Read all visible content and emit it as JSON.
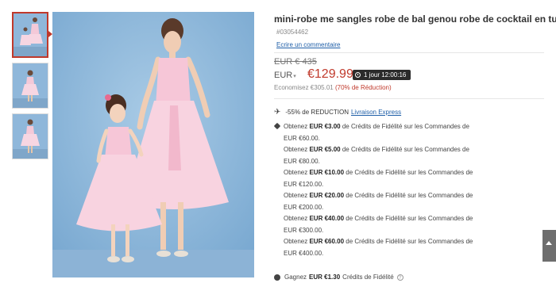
{
  "product": {
    "title": "mini-robe me sangles robe de bal genou robe de cocktail en tulle",
    "sku": "#03054462",
    "write_review": "Ecrire un commentaire"
  },
  "pricing": {
    "old_price": "EUR € 435",
    "currency_label": "EUR",
    "price": "€129.99",
    "countdown": "1 jour 12:00:16",
    "savings_label": "Economisez €305.01",
    "savings_pct": "(70% de Réduction)"
  },
  "shipping": {
    "discount_text": "-55% de REDUCTION",
    "link_text": "Livraison Express"
  },
  "rewards": [
    {
      "prefix": "Obtenez ",
      "amount": "EUR €3.00",
      "middle": " de Crédits de Fidélité sur les Commandes de",
      "threshold": "EUR €60.00."
    },
    {
      "prefix": "Obtenez ",
      "amount": "EUR €5.00",
      "middle": " de Crédits de Fidélité sur les Commandes de",
      "threshold": "EUR €80.00."
    },
    {
      "prefix": "Obtenez ",
      "amount": "EUR €10.00",
      "middle": " de Crédits de Fidélité sur les Commandes de",
      "threshold": "EUR €120.00."
    },
    {
      "prefix": "Obtenez ",
      "amount": "EUR €20.00",
      "middle": " de Crédits de Fidélité sur les Commandes de",
      "threshold": "EUR €200.00."
    },
    {
      "prefix": "Obtenez ",
      "amount": "EUR €40.00",
      "middle": " de Crédits de Fidélité sur les Commandes de",
      "threshold": "EUR €300.00."
    },
    {
      "prefix": "Obtenez ",
      "amount": "EUR €60.00",
      "middle": " de Crédits de Fidélité sur les Commandes de",
      "threshold": "EUR €400.00."
    }
  ],
  "earn": {
    "prefix": "Gagnez",
    "amount": "EUR €1.30",
    "suffix": "Crédits de Fidélité",
    "help": "?"
  },
  "colors": {
    "accent": "#c0392b",
    "link": "#1f5fa8",
    "photo_background": "#8fb7da",
    "dress_pink": "#f4c9d8"
  },
  "icons": {
    "shipping": "plane-icon",
    "reward": "tag-icon",
    "earn": "coin-icon",
    "countdown": "clock-icon",
    "scroll": "arrow-up-icon"
  }
}
